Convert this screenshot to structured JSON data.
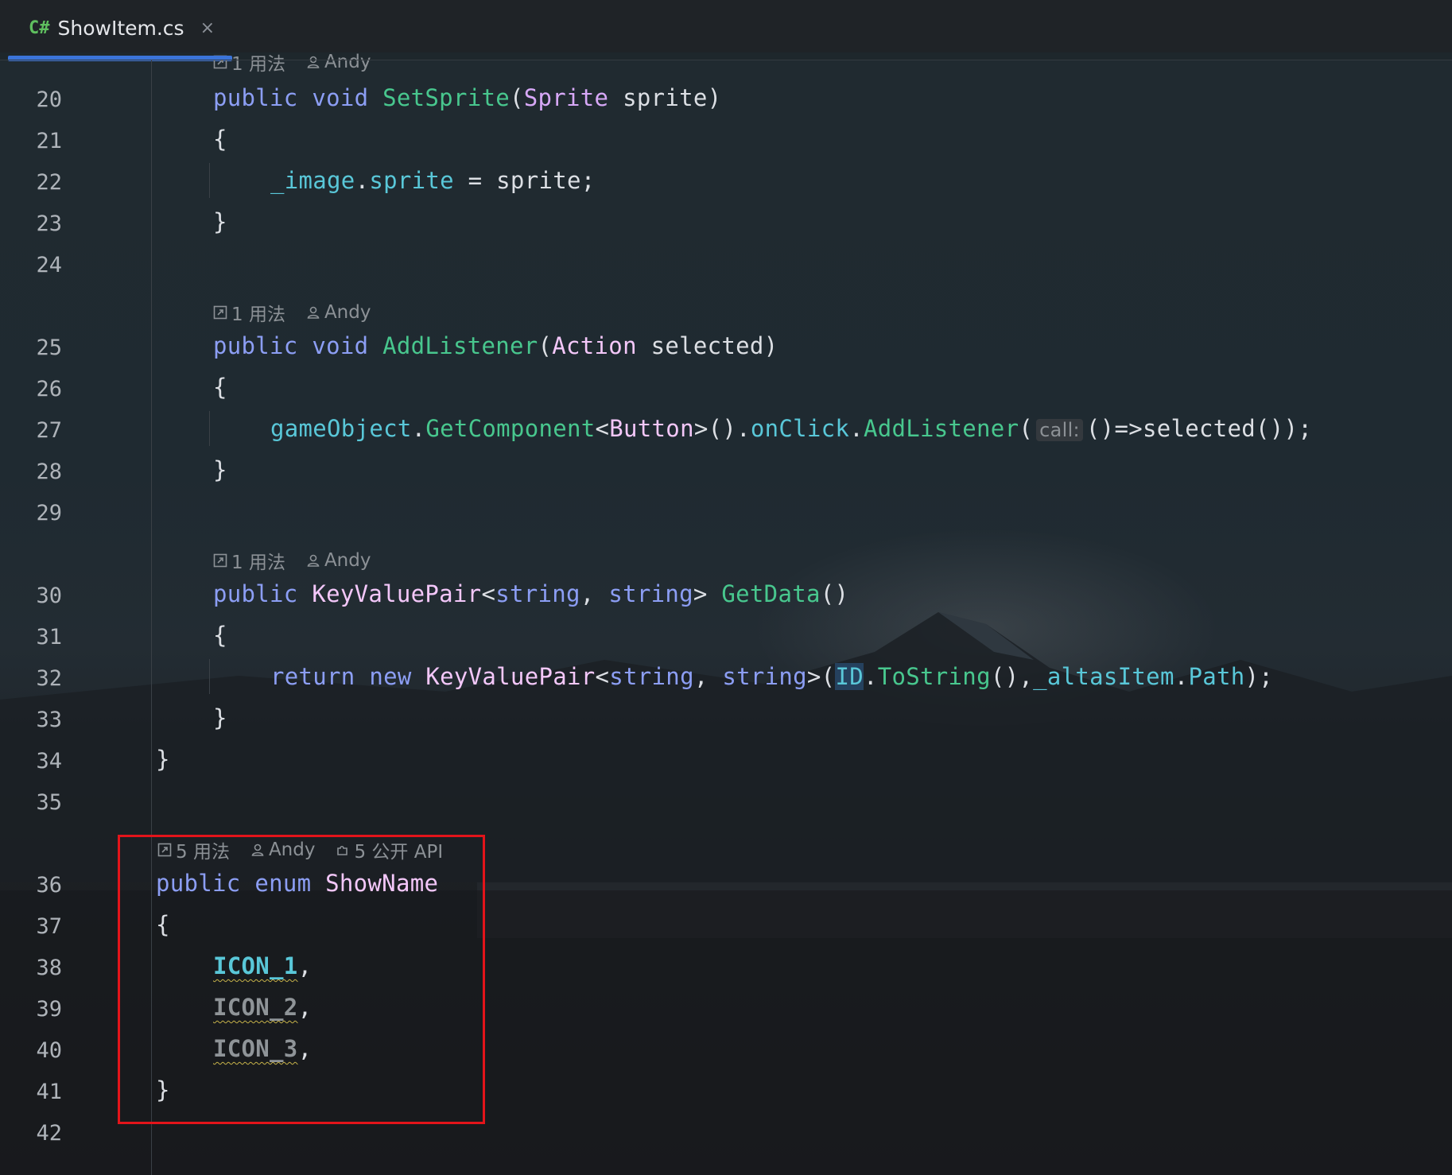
{
  "tab": {
    "lang_badge": "C#",
    "file_name": "ShowItem.cs",
    "close_glyph": "×",
    "accent": "#3b74d9"
  },
  "hints": {
    "h0": {
      "usages": "1 用法",
      "author": "Andy"
    },
    "h1": {
      "usages": "1 用法",
      "author": "Andy"
    },
    "h2": {
      "usages": "1 用法",
      "author": "Andy"
    },
    "h3": {
      "usages": "5 用法",
      "author": "Andy",
      "api": "5 公开 API"
    }
  },
  "line_numbers": [
    "20",
    "21",
    "22",
    "23",
    "24",
    "25",
    "26",
    "27",
    "28",
    "29",
    "30",
    "31",
    "32",
    "33",
    "34",
    "35",
    "36",
    "37",
    "38",
    "39",
    "40",
    "41",
    "42"
  ],
  "code": {
    "l20": {
      "kw1": "public",
      "kw2": "void",
      "fn": "SetSprite",
      "p1": "(",
      "ty": "Sprite",
      "rest": " sprite)"
    },
    "l21": "{",
    "l22": {
      "fld1": "_image",
      "dot": ".",
      "fld2": "sprite",
      "rest": " = sprite;"
    },
    "l23": "}",
    "l25": {
      "kw1": "public",
      "kw2": "void",
      "fn": "AddListener",
      "p1": "(",
      "ty": "Action",
      "rest": " selected)"
    },
    "l26": "{",
    "l27": {
      "a": "gameObject",
      "b": ".",
      "c": "GetComponent",
      "d": "<",
      "e": "Button",
      "f": ">().",
      "g": "onClick",
      "h": ".",
      "i": "AddListener",
      "j": "(",
      "hint": "call:",
      "k": "()=>selected());"
    },
    "l28": "}",
    "l30": {
      "kw1": "public",
      "ty": "KeyValuePair",
      "lt": "<",
      "kw2": "string",
      "comma": ", ",
      "kw3": "string",
      "gt": "> ",
      "fn": "GetData",
      "rest": "()"
    },
    "l31": "{",
    "l32": {
      "kw1": "return",
      "kw2": "new",
      "ty": "KeyValuePair",
      "lt": "<",
      "kw3": "string",
      "comma": ", ",
      "kw4": "string",
      "gt": ">(",
      "id": "ID",
      "dot": ".",
      "fn": "ToString",
      "mid": "(),",
      "fld": "_altasItem",
      "dot2": ".",
      "fld2": "Path",
      "end": ");"
    },
    "l33": "}",
    "l34": "}",
    "l36": {
      "kw1": "public",
      "kw2": "enum",
      "ty": "ShowName"
    },
    "l37": "{",
    "l38": {
      "name": "ICON_1",
      "comma": ","
    },
    "l39": {
      "name": "ICON_2",
      "comma": ","
    },
    "l40": {
      "name": "ICON_3",
      "comma": ","
    },
    "l41": "}"
  },
  "highlight_color": "#e3141a"
}
